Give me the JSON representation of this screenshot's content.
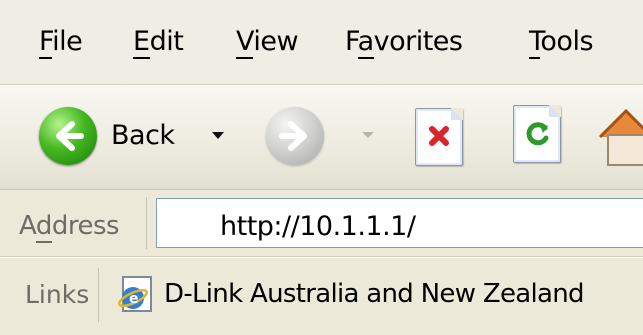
{
  "menu": {
    "items": [
      {
        "prefix": "",
        "accel": "F",
        "rest": "ile"
      },
      {
        "prefix": "",
        "accel": "E",
        "rest": "dit"
      },
      {
        "prefix": "",
        "accel": "V",
        "rest": "iew"
      },
      {
        "prefix": "F",
        "accel": "a",
        "rest": "vorites"
      },
      {
        "prefix": "",
        "accel": "T",
        "rest": "ools"
      }
    ]
  },
  "toolbar": {
    "back_label": "Back",
    "icons": [
      "back-arrow-icon",
      "forward-arrow-icon",
      "stop-icon",
      "refresh-icon",
      "home-icon"
    ],
    "colors": {
      "back": "#3bae1c",
      "stop": "#d8252b",
      "refresh": "#2b9c2a"
    }
  },
  "address": {
    "label_prefix": "A",
    "label_accel": "d",
    "label_rest": "dress",
    "url": "http://10.1.1.1/"
  },
  "links": {
    "label": "Links",
    "items": [
      {
        "text": "D-Link Australia and New Zealand",
        "icon": "ie-page-icon"
      }
    ]
  }
}
